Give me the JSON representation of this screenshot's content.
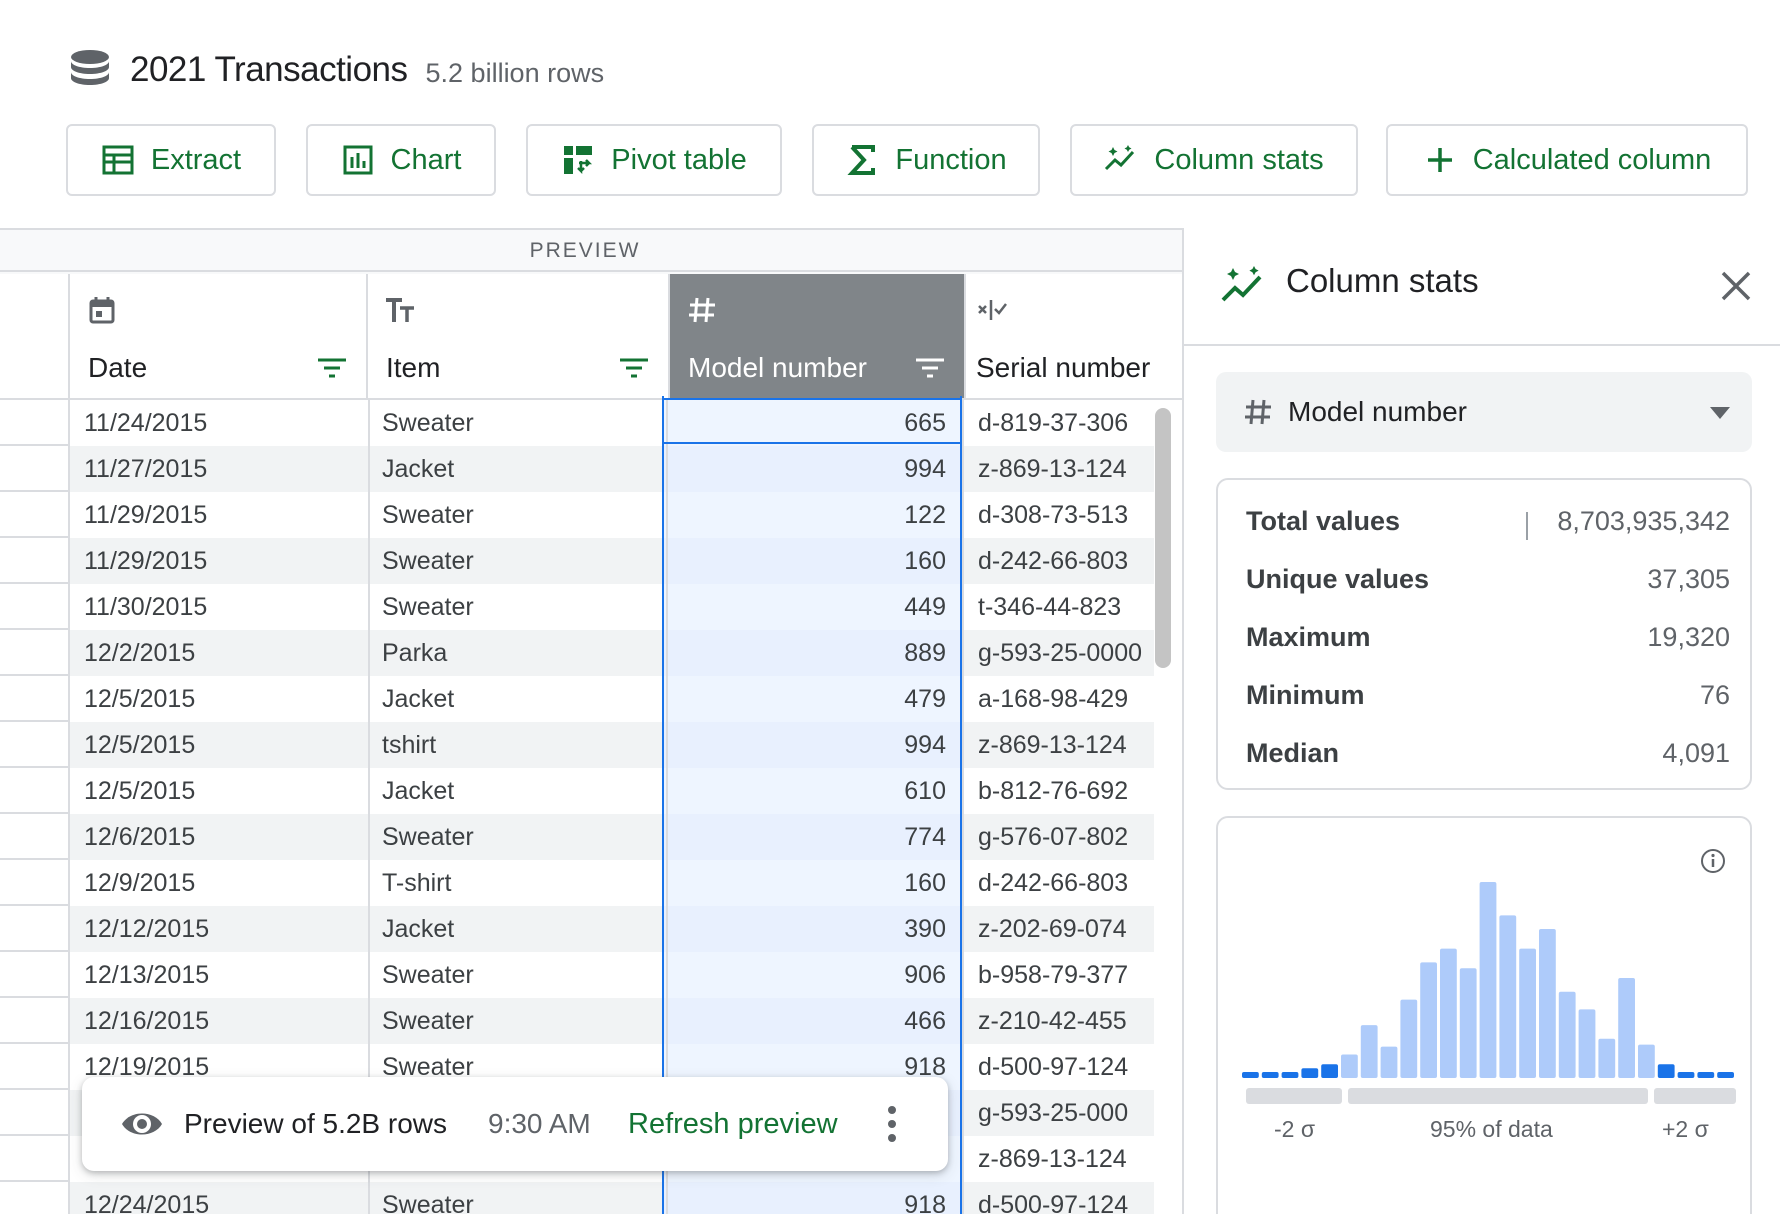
{
  "header": {
    "title": "2021 Transactions",
    "subtitle": "5.2 billion rows"
  },
  "toolbar": {
    "extract": "Extract",
    "chart": "Chart",
    "pivot": "Pivot table",
    "function": "Function",
    "column_stats": "Column stats",
    "calculated": "Calculated column"
  },
  "preview_label": "PREVIEW",
  "columns": {
    "date": "Date",
    "item": "Item",
    "model": "Model number",
    "serial": "Serial number"
  },
  "rows": [
    {
      "date": "11/24/2015",
      "item": "Sweater",
      "model": "665",
      "serial": "d-819-37-306"
    },
    {
      "date": "11/27/2015",
      "item": "Jacket",
      "model": "994",
      "serial": "z-869-13-124"
    },
    {
      "date": "11/29/2015",
      "item": "Sweater",
      "model": "122",
      "serial": "d-308-73-513"
    },
    {
      "date": "11/29/2015",
      "item": "Sweater",
      "model": "160",
      "serial": "d-242-66-803"
    },
    {
      "date": "11/30/2015",
      "item": "Sweater",
      "model": "449",
      "serial": "t-346-44-823"
    },
    {
      "date": "12/2/2015",
      "item": "Parka",
      "model": "889",
      "serial": "g-593-25-0000"
    },
    {
      "date": "12/5/2015",
      "item": "Jacket",
      "model": "479",
      "serial": "a-168-98-429"
    },
    {
      "date": "12/5/2015",
      "item": "tshirt",
      "model": "994",
      "serial": "z-869-13-124"
    },
    {
      "date": "12/5/2015",
      "item": "Jacket",
      "model": "610",
      "serial": "b-812-76-692"
    },
    {
      "date": "12/6/2015",
      "item": "Sweater",
      "model": "774",
      "serial": "g-576-07-802"
    },
    {
      "date": "12/9/2015",
      "item": "T-shirt",
      "model": "160",
      "serial": "d-242-66-803"
    },
    {
      "date": "12/12/2015",
      "item": "Jacket",
      "model": "390",
      "serial": "z-202-69-074"
    },
    {
      "date": "12/13/2015",
      "item": "Sweater",
      "model": "906",
      "serial": "b-958-79-377"
    },
    {
      "date": "12/16/2015",
      "item": "Sweater",
      "model": "466",
      "serial": "z-210-42-455"
    },
    {
      "date": "12/19/2015",
      "item": "Sweater",
      "model": "918",
      "serial": "d-500-97-124"
    },
    {
      "date": "",
      "item": "",
      "model": "",
      "serial": "g-593-25-000"
    },
    {
      "date": "",
      "item": "",
      "model": "",
      "serial": "z-869-13-124"
    },
    {
      "date": "12/24/2015",
      "item": "Sweater",
      "model": "918",
      "serial": "d-500-97-124"
    }
  ],
  "toast": {
    "message": "Preview of 5.2B rows",
    "time": "9:30 AM",
    "action": "Refresh preview"
  },
  "panel": {
    "title": "Column stats",
    "selected_column": "Model number",
    "stats": [
      {
        "label": "Total values",
        "value": "8,703,935,342"
      },
      {
        "label": "Unique values",
        "value": "37,305"
      },
      {
        "label": "Maximum",
        "value": "19,320"
      },
      {
        "label": "Minimum",
        "value": "76"
      },
      {
        "label": "Median",
        "value": "4,091"
      }
    ],
    "histogram": {
      "bars": [
        0.01,
        0.02,
        0.02,
        0.05,
        0.07,
        0.12,
        0.27,
        0.16,
        0.4,
        0.59,
        0.66,
        0.56,
        1.0,
        0.83,
        0.66,
        0.76,
        0.44,
        0.35,
        0.2,
        0.51,
        0.17,
        0.07,
        0.02,
        0.01,
        0.01
      ],
      "outlier_color": "#1a73e8",
      "inner_color": "#aecbfa",
      "left_label": "-2 σ",
      "center_label": "95% of data",
      "right_label": "+2 σ"
    }
  },
  "colors": {
    "accent_green": "#137333",
    "selection_blue": "#1a73e8",
    "header_selected": "#808589"
  }
}
